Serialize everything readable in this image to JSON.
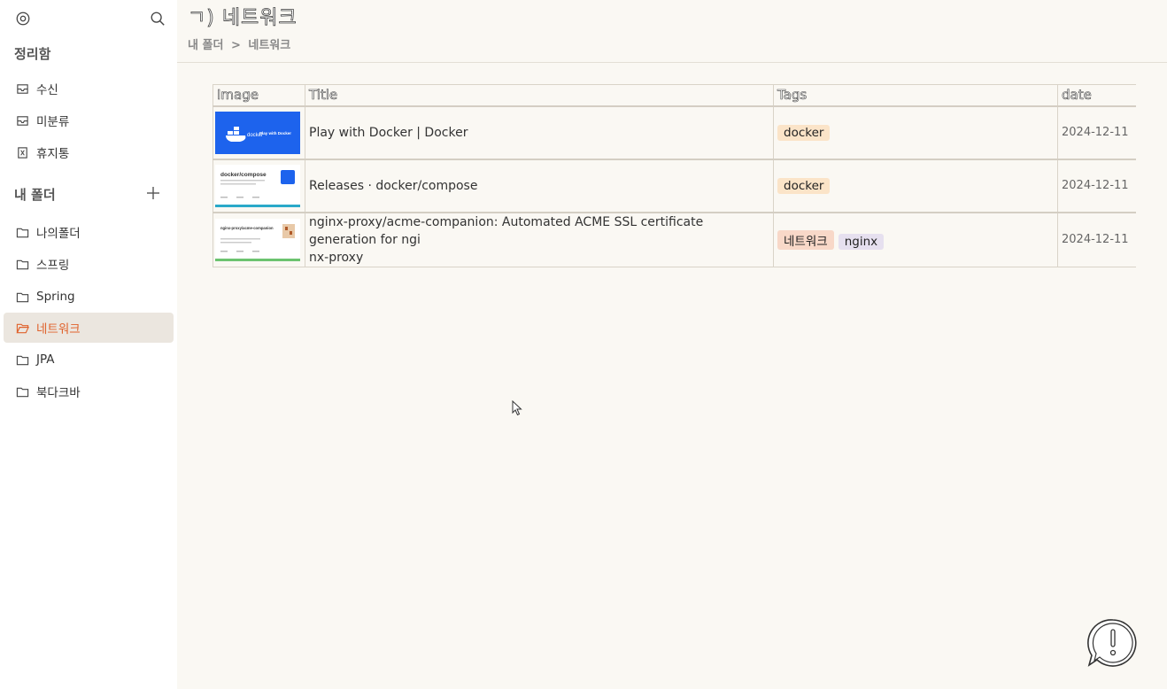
{
  "sidebar": {
    "section_organize": "정리함",
    "organize_items": [
      {
        "label": "수신",
        "icon": "inbox-icon"
      },
      {
        "label": "미분류",
        "icon": "inbox-icon"
      },
      {
        "label": "휴지통",
        "icon": "trash-icon"
      }
    ],
    "section_folders": "내 폴더",
    "folders": [
      {
        "label": "나의폴더"
      },
      {
        "label": "스프링"
      },
      {
        "label": "Spring"
      },
      {
        "label": "네트워크",
        "active": true
      },
      {
        "label": "JPA"
      },
      {
        "label": "북다크바"
      }
    ]
  },
  "page": {
    "title": "ㄱ) 네트워크",
    "breadcrumb": [
      "내 폴더",
      ">",
      "네트워크"
    ]
  },
  "table": {
    "headers": [
      "Image",
      "Title",
      "Tags",
      "date"
    ],
    "rows": [
      {
        "thumb_text": "Play with Docker",
        "thumb_brand": "docker",
        "title": "Play with Docker | Docker",
        "tags": [
          "docker"
        ],
        "date": "2024-12-11"
      },
      {
        "thumb_text": "docker/compose",
        "title": "Releases · docker/compose",
        "tags": [
          "docker"
        ],
        "date": "2024-12-11"
      },
      {
        "thumb_text": "nginx-proxy/acme-companion",
        "title_line1": "nginx-proxy/acme-companion: Automated ACME SSL certificate generation for ngi",
        "title_line2": "nx-proxy",
        "tags": [
          "네트워크",
          "nginx"
        ],
        "date": "2024-12-11"
      }
    ]
  },
  "colors": {
    "accent": "#e0622c",
    "main_bg": "#faf8f3",
    "active_bg": "#ebe6df"
  }
}
